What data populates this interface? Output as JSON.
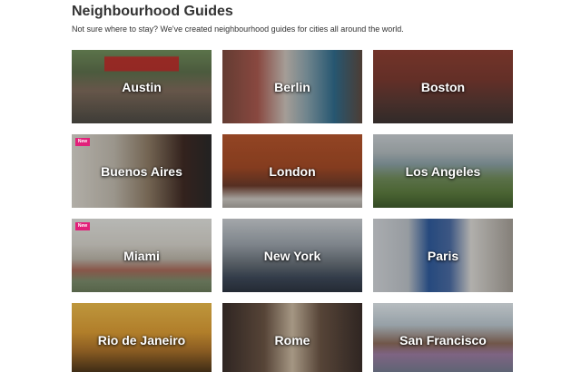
{
  "header": {
    "title": "Neighbourhood Guides",
    "subtitle": "Not sure where to stay? We've created neighbourhood guides for cities all around the world."
  },
  "badge_color": "#e2207a",
  "guides": [
    {
      "city": "Austin",
      "badge": "",
      "icon": "austin-photo"
    },
    {
      "city": "Berlin",
      "badge": "",
      "icon": "berlin-photo"
    },
    {
      "city": "Boston",
      "badge": "",
      "icon": "boston-photo"
    },
    {
      "city": "Buenos Aires",
      "badge": "New",
      "icon": "buenos-aires-photo"
    },
    {
      "city": "London",
      "badge": "",
      "icon": "london-photo"
    },
    {
      "city": "Los Angeles",
      "badge": "",
      "icon": "los-angeles-photo"
    },
    {
      "city": "Miami",
      "badge": "New",
      "icon": "miami-photo"
    },
    {
      "city": "New York",
      "badge": "",
      "icon": "new-york-photo"
    },
    {
      "city": "Paris",
      "badge": "",
      "icon": "paris-photo"
    },
    {
      "city": "Rio de Janeiro",
      "badge": "",
      "icon": "rio-de-janeiro-photo"
    },
    {
      "city": "Rome",
      "badge": "",
      "icon": "rome-photo"
    },
    {
      "city": "San Francisco",
      "badge": "",
      "icon": "san-francisco-photo"
    }
  ]
}
